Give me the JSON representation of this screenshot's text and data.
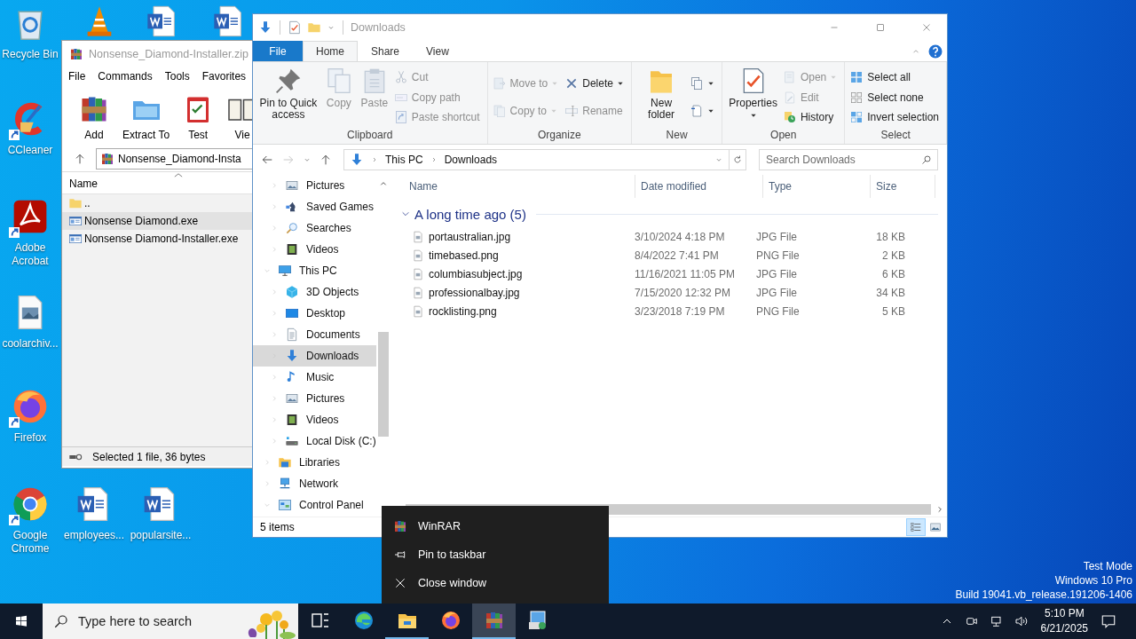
{
  "desktop": {
    "icons": [
      {
        "label": "Recycle Bin",
        "kind": "recycle",
        "shortcut": false
      },
      {
        "label": "CCleaner",
        "kind": "ccleaner",
        "shortcut": true
      },
      {
        "label": "Adobe Acrobat",
        "kind": "acrobat",
        "shortcut": true
      },
      {
        "label": "coolarchiv...",
        "kind": "image",
        "shortcut": false
      },
      {
        "label": "Firefox",
        "kind": "firefox",
        "shortcut": true
      },
      {
        "label": "Google Chrome",
        "kind": "chrome",
        "shortcut": true
      },
      {
        "label": "employees...",
        "kind": "word",
        "shortcut": false
      },
      {
        "label": "popularsite...",
        "kind": "word",
        "shortcut": false
      }
    ],
    "covered_icons": [
      {
        "kind": "vlc"
      },
      {
        "kind": "word"
      },
      {
        "kind": "word"
      }
    ],
    "system_text": [
      "Test Mode",
      "Windows 10 Pro",
      "Build 19041.vb_release.191206-1406"
    ]
  },
  "winrar": {
    "title": "Nonsense_Diamond-Installer.zip",
    "menu": [
      "File",
      "Commands",
      "Tools",
      "Favorites"
    ],
    "toolbar": [
      {
        "label": "Add",
        "kind": "winrar"
      },
      {
        "label": "Extract To",
        "kind": "extract"
      },
      {
        "label": "Test",
        "kind": "test"
      },
      {
        "label": "Vie",
        "kind": "view"
      }
    ],
    "address": "Nonsense_Diamond-Insta",
    "column": "Name",
    "files": [
      {
        "name": "..",
        "kind": "folder",
        "selected": false
      },
      {
        "name": "Nonsense Diamond.exe",
        "kind": "exe",
        "selected": true
      },
      {
        "name": "Nonsense Diamond-Installer.exe",
        "kind": "exe",
        "selected": false
      }
    ],
    "status": "Selected 1 file, 36 bytes"
  },
  "explorer": {
    "title": "Downloads",
    "file_tab": "File",
    "tabs": [
      {
        "label": "Home",
        "selected": true
      },
      {
        "label": "Share",
        "selected": false
      },
      {
        "label": "View",
        "selected": false
      }
    ],
    "ribbon": [
      {
        "label": "Clipboard",
        "columns": [
          [
            {
              "label": "Pin to Quick access",
              "kind": "large",
              "disabled": false,
              "dropdown": false
            }
          ],
          [
            {
              "label": "Copy",
              "kind": "large",
              "disabled": true,
              "dropdown": false
            }
          ],
          [
            {
              "label": "Paste",
              "kind": "large",
              "disabled": true,
              "dropdown": false
            }
          ],
          [
            {
              "label": "Cut",
              "kind": "small",
              "disabled": true,
              "dropdown": false
            },
            {
              "label": "Copy path",
              "kind": "small",
              "disabled": true,
              "dropdown": false
            },
            {
              "label": "Paste shortcut",
              "kind": "small",
              "disabled": true,
              "dropdown": false
            }
          ]
        ]
      },
      {
        "label": "Organize",
        "columns": [
          [
            {
              "label": "Move to",
              "kind": "small",
              "disabled": true,
              "dropdown": true
            },
            {
              "label": "Copy to",
              "kind": "small",
              "disabled": true,
              "dropdown": true
            }
          ],
          [
            {
              "label": "Delete",
              "kind": "small",
              "disabled": false,
              "dropdown": true
            },
            {
              "label": "Rename",
              "kind": "small",
              "disabled": true,
              "dropdown": false
            }
          ]
        ]
      },
      {
        "label": "New",
        "columns": [
          [
            {
              "label": "New folder",
              "kind": "large",
              "disabled": false,
              "dropdown": false
            }
          ],
          [
            {
              "kind": "icon",
              "disabled": false,
              "dropdown": true
            },
            {
              "kind": "icon",
              "disabled": false,
              "dropdown": true
            }
          ]
        ]
      },
      {
        "label": "Open",
        "columns": [
          [
            {
              "label": "Properties",
              "kind": "large",
              "disabled": false,
              "dropdown": true
            }
          ],
          [
            {
              "label": "Open",
              "kind": "small",
              "disabled": true,
              "dropdown": true
            },
            {
              "label": "Edit",
              "kind": "small",
              "disabled": true,
              "dropdown": false
            },
            {
              "label": "History",
              "kind": "small",
              "disabled": false,
              "dropdown": false
            }
          ]
        ]
      },
      {
        "label": "Select",
        "columns": [
          [
            {
              "label": "Select all",
              "kind": "small",
              "disabled": false,
              "dropdown": false
            },
            {
              "label": "Select none",
              "kind": "small",
              "disabled": false,
              "dropdown": false
            },
            {
              "label": "Invert selection",
              "kind": "small",
              "disabled": false,
              "dropdown": false
            }
          ]
        ]
      }
    ],
    "address": {
      "crumbs": [
        "This PC",
        "Downloads"
      ]
    },
    "search": {
      "placeholder": "Search Downloads"
    },
    "nav": {
      "continued": [
        {
          "label": "Pictures",
          "expanded": false,
          "selected": false
        },
        {
          "label": "Saved Games",
          "expanded": false,
          "selected": false
        },
        {
          "label": "Searches",
          "expanded": false,
          "selected": false
        },
        {
          "label": "Videos",
          "expanded": false,
          "selected": false
        }
      ],
      "tree": [
        {
          "label": "This PC",
          "expanded": true,
          "selected": false,
          "children": [
            {
              "label": "3D Objects",
              "expanded": false,
              "selected": false
            },
            {
              "label": "Desktop",
              "expanded": false,
              "selected": false
            },
            {
              "label": "Documents",
              "expanded": false,
              "selected": false
            },
            {
              "label": "Downloads",
              "expanded": false,
              "selected": true
            },
            {
              "label": "Music",
              "expanded": false,
              "selected": false
            },
            {
              "label": "Pictures",
              "expanded": false,
              "selected": false
            },
            {
              "label": "Videos",
              "expanded": false,
              "selected": false
            },
            {
              "label": "Local Disk (C:)",
              "expanded": false,
              "selected": false
            }
          ]
        },
        {
          "label": "Libraries",
          "expanded": false,
          "selected": false
        },
        {
          "label": "Network",
          "expanded": false,
          "selected": false
        },
        {
          "label": "Control Panel",
          "expanded": true,
          "selected": false
        }
      ]
    },
    "content": {
      "columns": [
        "Name",
        "Date modified",
        "Type",
        "Size"
      ],
      "groups": [
        {
          "label": "A long time ago (5)",
          "expanded": true,
          "files": [
            {
              "name": "portaustralian.jpg",
              "date": "3/10/2024 4:18 PM",
              "type": "JPG File",
              "size": "18 KB"
            },
            {
              "name": "timebased.png",
              "date": "8/4/2022 7:41 PM",
              "type": "PNG File",
              "size": "2 KB"
            },
            {
              "name": "columbiasubject.jpg",
              "date": "11/16/2021 11:05 PM",
              "type": "JPG File",
              "size": "6 KB"
            },
            {
              "name": "professionalbay.jpg",
              "date": "7/15/2020 12:32 PM",
              "type": "JPG File",
              "size": "34 KB"
            },
            {
              "name": "rocklisting.png",
              "date": "3/23/2018 7:19 PM",
              "type": "PNG File",
              "size": "5 KB"
            }
          ]
        }
      ]
    },
    "status": {
      "text": "5 items",
      "views": [
        {
          "kind": "details",
          "selected": true
        },
        {
          "kind": "large",
          "selected": false
        }
      ]
    }
  },
  "context_menu": [
    {
      "label": "WinRAR",
      "kind": "app"
    },
    {
      "label": "Pin to taskbar",
      "kind": "pin"
    },
    {
      "label": "Close window",
      "kind": "close"
    }
  ],
  "taskbar": {
    "search_placeholder": "Type here to search",
    "apps": [
      {
        "kind": "taskview",
        "running": false,
        "selected": false
      },
      {
        "kind": "edge",
        "running": false,
        "selected": false
      },
      {
        "kind": "explorer",
        "running": true,
        "selected": false
      },
      {
        "kind": "firefox",
        "running": false,
        "selected": false
      },
      {
        "kind": "winrar",
        "running": true,
        "selected": true
      },
      {
        "kind": "installer",
        "running": false,
        "selected": false
      }
    ],
    "clock": {
      "time": "5:10 PM",
      "date": "6/21/2025"
    }
  }
}
